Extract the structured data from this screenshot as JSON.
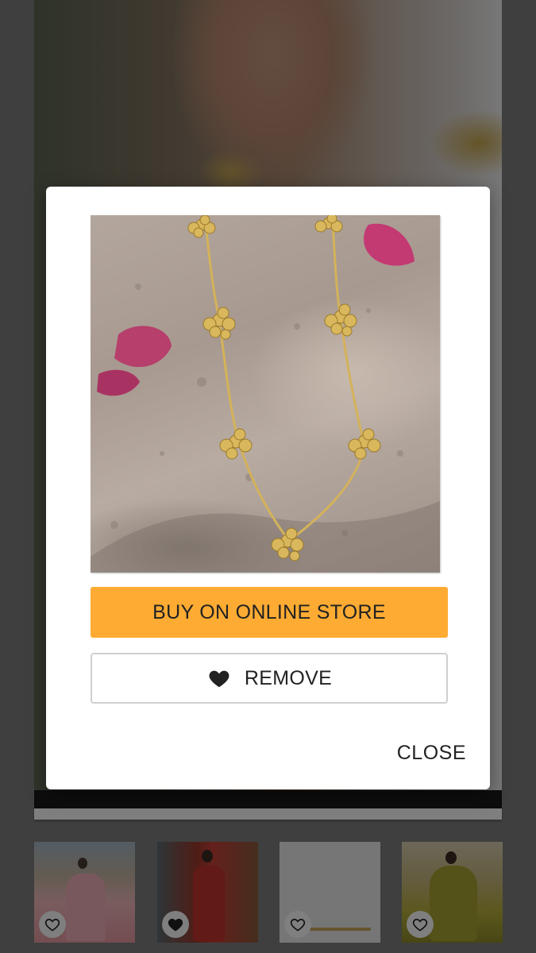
{
  "modal": {
    "product_image_alt": "",
    "buy_label": "BUY ON ONLINE STORE",
    "remove_label": "REMOVE",
    "close_label": "CLOSE",
    "colors": {
      "buy_button": "#fdab33",
      "overlay": "rgba(0,0,0,0.5)"
    }
  },
  "background": {
    "thumbnails": [
      {
        "icon": "heart-outline-icon",
        "favorited": false
      },
      {
        "icon": "heart-filled-icon",
        "favorited": true
      },
      {
        "icon": "heart-outline-icon",
        "favorited": false
      },
      {
        "icon": "heart-outline-icon",
        "favorited": false
      }
    ]
  }
}
